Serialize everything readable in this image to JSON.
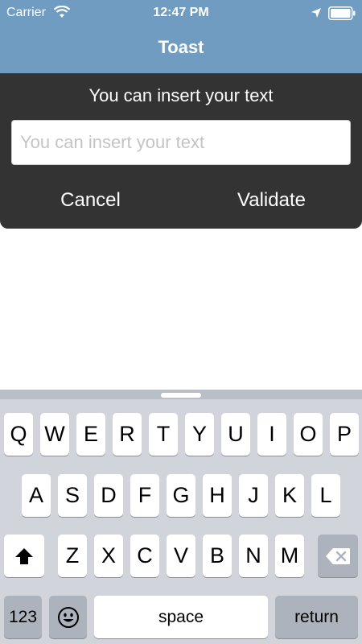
{
  "status_bar": {
    "carrier": "Carrier",
    "time": "12:47 PM",
    "icons": [
      "wifi-icon",
      "location-icon",
      "battery-icon"
    ]
  },
  "nav": {
    "title": "Toast"
  },
  "toast": {
    "message": "You can insert your text",
    "input_placeholder": "You can insert your text",
    "input_value": "",
    "cancel_label": "Cancel",
    "validate_label": "Validate"
  },
  "keyboard": {
    "row1": [
      "Q",
      "W",
      "E",
      "R",
      "T",
      "Y",
      "U",
      "I",
      "O",
      "P"
    ],
    "row2": [
      "A",
      "S",
      "D",
      "F",
      "G",
      "H",
      "J",
      "K",
      "L"
    ],
    "row3": [
      "Z",
      "X",
      "C",
      "V",
      "B",
      "N",
      "M"
    ],
    "numbers_label": "123",
    "space_label": "space",
    "return_label": "return",
    "icons": [
      "shift-icon",
      "backspace-icon",
      "emoji-icon"
    ]
  },
  "colors": {
    "header": "#6f9cc0",
    "toast_background": "#333333",
    "keyboard_background": "#d1d5db",
    "key": "#ffffff",
    "key_dark": "#adb3bc"
  }
}
